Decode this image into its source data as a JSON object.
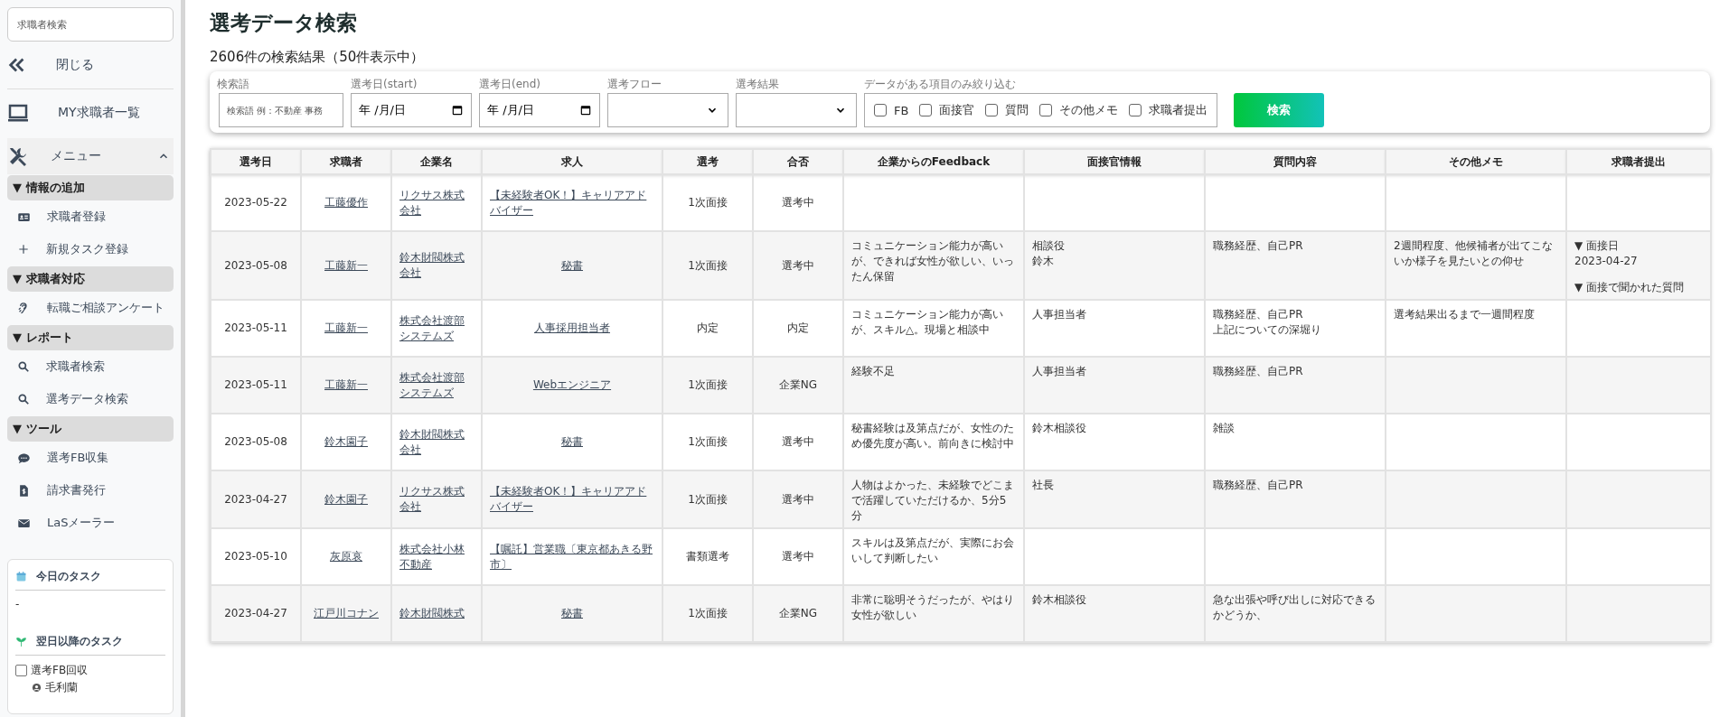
{
  "sidebar": {
    "search": {
      "placeholder": "求職者検索"
    },
    "top_items": [
      {
        "label": "閉じる"
      },
      {
        "label": "MY求職者一覧"
      }
    ],
    "menu": {
      "label": "メニュー",
      "expanded": true
    },
    "groups": [
      {
        "title": "▼ 情報の追加",
        "items": [
          {
            "label": "求職者登録"
          },
          {
            "label": "新規タスク登録"
          }
        ]
      },
      {
        "title": "▼ 求職者対応",
        "items": [
          {
            "label": "転職ご相談アンケート"
          }
        ]
      },
      {
        "title": "▼ レポート",
        "items": [
          {
            "label": "求職者検索"
          },
          {
            "label": "選考データ検索"
          }
        ]
      },
      {
        "title": "▼ ツール",
        "items": [
          {
            "label": "選考FB収集"
          },
          {
            "label": "請求書発行"
          },
          {
            "label": "LaSメーラー"
          }
        ]
      }
    ],
    "tasks": {
      "today_title": "今日のタスク",
      "today_items": [
        "-"
      ],
      "later_title": "翌日以降のタスク",
      "later_items": [
        {
          "label": "選考FB回収",
          "checked": false,
          "person": "毛利蘭"
        }
      ]
    }
  },
  "page": {
    "title": "選考データ検索",
    "result_count": "2606件の検索結果（50件表示中）"
  },
  "filters": {
    "keyword": {
      "label": "検索語",
      "placeholder": "検索語 例：不動産 事務"
    },
    "date_start": {
      "label": "選考日(start)",
      "value": "年 /月/日"
    },
    "date_end": {
      "label": "選考日(end)",
      "value": "年 /月/日"
    },
    "flow": {
      "label": "選考フロー"
    },
    "result": {
      "label": "選考結果"
    },
    "has_data": {
      "label": "データがある項目のみ絞り込む",
      "options": [
        {
          "label": "FB",
          "checked": false
        },
        {
          "label": "面接官",
          "checked": false
        },
        {
          "label": "質問",
          "checked": false
        },
        {
          "label": "その他メモ",
          "checked": false
        },
        {
          "label": "求職者提出",
          "checked": false
        }
      ]
    },
    "search_button": "検索"
  },
  "table": {
    "columns": [
      "選考日",
      "求職者",
      "企業名",
      "求人",
      "選考",
      "合否",
      "企業からのFeedback",
      "面接官情報",
      "質問内容",
      "その他メモ",
      "求職者提出"
    ],
    "rows": [
      {
        "date": "2023-05-22",
        "candidate": "工藤優作",
        "company": "リクサス株式会社",
        "job": "【未経験者OK！】キャリアアドバイザー",
        "stage": "1次面接",
        "result": "選考中",
        "feedback": "",
        "interviewer": [],
        "questions": [],
        "memo": "",
        "submission": []
      },
      {
        "date": "2023-05-08",
        "candidate": "工藤新一",
        "company": "鈴木財閥株式会社",
        "job": "秘書",
        "stage": "1次面接",
        "result": "選考中",
        "feedback": "コミュニケーション能力が高いが、できれば女性が欲しい、いったん保留",
        "interviewer": [
          "相談役",
          "鈴木"
        ],
        "questions": [
          "職務経歴、自己PR"
        ],
        "memo": "2週間程度、他候補者が出てこないか様子を見たいとの仰せ",
        "submission": [
          "▼ 面接日",
          "2023-04-27",
          "▼ 面接で聞かれた質問"
        ]
      },
      {
        "date": "2023-05-11",
        "candidate": "工藤新一",
        "company": "株式会社渡部システムズ",
        "job": "人事採用担当者",
        "stage": "内定",
        "result": "内定",
        "feedback": "コミュニケーション能力が高いが、スキル△。現場と相談中",
        "interviewer": [
          "人事担当者"
        ],
        "questions": [
          "職務経歴、自己PR",
          "上記についての深堀り"
        ],
        "memo": "選考結果出るまで一週間程度",
        "submission": []
      },
      {
        "date": "2023-05-11",
        "candidate": "工藤新一",
        "company": "株式会社渡部システムズ",
        "job": "Webエンジニア",
        "stage": "1次面接",
        "result": "企業NG",
        "feedback": "経験不足",
        "interviewer": [
          "人事担当者"
        ],
        "questions": [
          "職務経歴、自己PR"
        ],
        "memo": "",
        "submission": []
      },
      {
        "date": "2023-05-08",
        "candidate": "鈴木園子",
        "company": "鈴木財閥株式会社",
        "job": "秘書",
        "stage": "1次面接",
        "result": "選考中",
        "feedback": "秘書経験は及第点だが、女性のため優先度が高い。前向きに検討中",
        "interviewer": [
          "鈴木相談役"
        ],
        "questions": [
          "雑談"
        ],
        "memo": "",
        "submission": []
      },
      {
        "date": "2023-04-27",
        "candidate": "鈴木園子",
        "company": "リクサス株式会社",
        "job": "【未経験者OK！】キャリアアドバイザー",
        "stage": "1次面接",
        "result": "選考中",
        "feedback": "人物はよかった、未経験でどこまで活躍していただけるか、5分5分",
        "interviewer": [
          "社長"
        ],
        "questions": [
          "職務経歴、自己PR"
        ],
        "memo": "",
        "submission": []
      },
      {
        "date": "2023-05-10",
        "candidate": "灰原哀",
        "company": "株式会社小林不動産",
        "job": "【嘱託】営業職〔東京都あきる野市〕",
        "stage": "書類選考",
        "result": "選考中",
        "feedback": "スキルは及第点だが、実際にお会いして判断したい",
        "interviewer": [],
        "questions": [],
        "memo": "",
        "submission": []
      },
      {
        "date": "2023-04-27",
        "candidate": "江戸川コナン",
        "company": "鈴木財閥株式",
        "job": "秘書",
        "stage": "1次面接",
        "result": "企業NG",
        "feedback": "非常に聡明そうだったが、やはり女性が欲しい",
        "interviewer": [
          "鈴木相談役"
        ],
        "questions": [
          "急な出張や呼び出しに対応できるかどうか、"
        ],
        "memo": "",
        "submission": []
      }
    ]
  }
}
